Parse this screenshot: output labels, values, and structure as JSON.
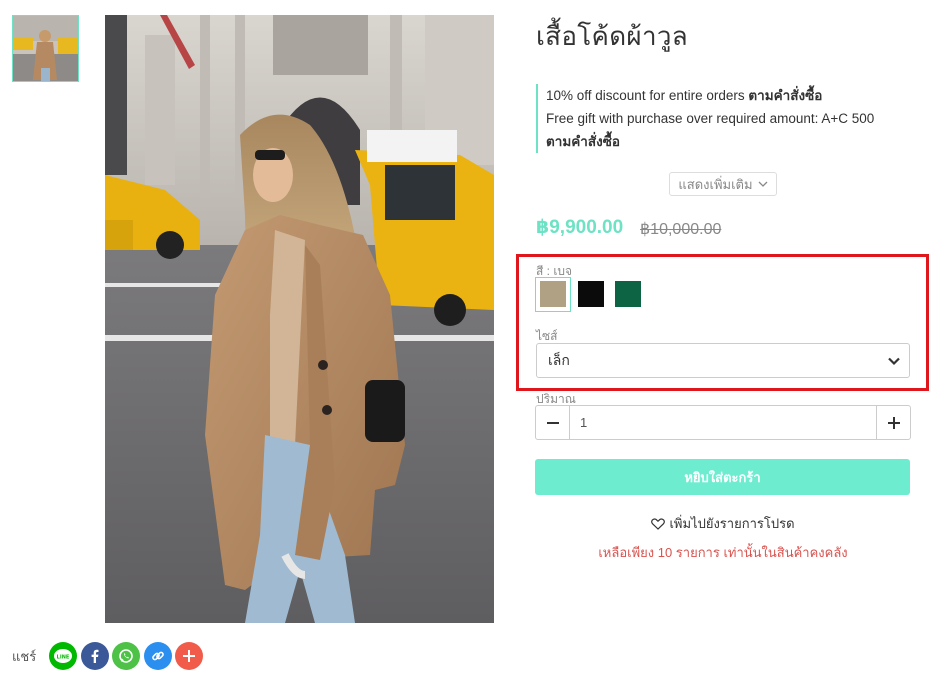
{
  "product": {
    "title": "เสื้อโค้ดผ้าวูล",
    "promotions": [
      {
        "text": "10% off discount for entire orders",
        "link": "ตามคำสั่งซื้อ"
      },
      {
        "text": "Free gift with purchase over required amount: A+C 500",
        "link": "ตามคำสั่งซื้อ"
      }
    ],
    "show_more": "แสดงเพิ่มเติม",
    "price": "฿9,900.00",
    "old_price": "฿10,000.00"
  },
  "options": {
    "color_label": "สี : เบจ",
    "colors": [
      {
        "name": "beige",
        "hex": "#b0a084"
      },
      {
        "name": "black",
        "hex": "#0b0b0b"
      },
      {
        "name": "green",
        "hex": "#0c6445"
      }
    ],
    "size_label": "ไซส์",
    "size_value": "เล็ก",
    "qty_label": "ปริมาณ",
    "qty_value": "1"
  },
  "actions": {
    "add_to_cart": "หยิบใส่ตะกร้า",
    "wishlist": "เพิ่มไปยังรายการโปรด",
    "stock_note": "เหลือเพียง 10 รายการ เท่านั้นในสินค้าคงคลัง"
  },
  "share": {
    "label": "แชร์",
    "buttons": [
      {
        "name": "line-share-button",
        "icon": "line-icon",
        "color": "#00b900"
      },
      {
        "name": "facebook-share-button",
        "icon": "facebook-icon",
        "color": "#3b5998"
      },
      {
        "name": "whatsapp-share-button",
        "icon": "whatsapp-icon",
        "color": "#4dc247"
      },
      {
        "name": "copy-link-button",
        "icon": "link-icon",
        "color": "#2b8ff0"
      },
      {
        "name": "more-share-button",
        "icon": "plus-icon",
        "color": "#f05b4a"
      }
    ]
  },
  "colors": {
    "accent": "#6ee2c4",
    "button": "#6eecd0",
    "warning": "#d9534f",
    "highlight_box": "#e0161d"
  }
}
